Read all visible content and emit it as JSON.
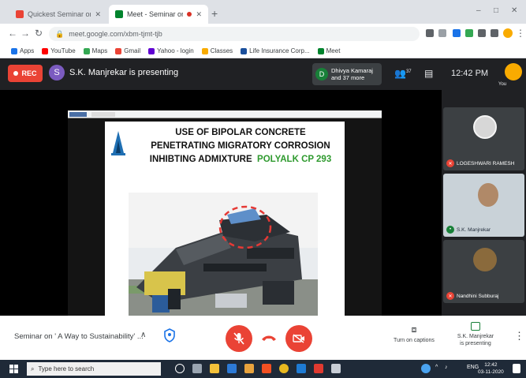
{
  "browser": {
    "tabs": [
      {
        "title": "Quickest Seminar on ' A Way t...",
        "favicon": "gmail-icon"
      },
      {
        "title": "Meet - Seminar on ' A Way t...",
        "favicon": "meet-icon",
        "active": true
      }
    ],
    "new_tab": "+",
    "window_controls": {
      "minimize": "–",
      "maximize": "□",
      "close": "✕"
    },
    "url": "meet.google.com/xbm-tjmt-tjb",
    "bookmarks": [
      "Apps",
      "YouTube",
      "Maps",
      "Gmail",
      "Yahoo - login",
      "Classes",
      "Life Insurance Corp...",
      "Meet"
    ]
  },
  "meet": {
    "rec_label": "REC",
    "presenter_initial": "S",
    "presenting_text": "S.K. Manjrekar is presenting",
    "joined": {
      "initial": "D",
      "line1": "Dhivya Kamaraj",
      "line2": "and 37 more"
    },
    "clock": "12:42 PM",
    "self_label": "You",
    "participant_count": "37",
    "slide": {
      "title_line1": "USE OF BIPOLAR CONCRETE",
      "title_line2": "PENETRATING MIGRATORY CORROSION",
      "title_line3_prefix": "INHIBTING ADMIXTURE",
      "title_line3_product": "POLYALK CP 293"
    },
    "participants": [
      {
        "name": "LOGESHWARI RAMESH"
      },
      {
        "name": "S.K. Manjrekar"
      },
      {
        "name": "Nandhini Subburaj"
      }
    ],
    "meeting_title": "Seminar on ' A Way to Sustainability' ...",
    "captions_label": "Turn on captions",
    "presenting_now_line1": "S.K. Manjrekar",
    "presenting_now_line2": "is presenting"
  },
  "taskbar": {
    "search_placeholder": "Type here to search",
    "lang": "ENG",
    "time": "12:42",
    "date": "03-11-2020"
  },
  "colors": {
    "meet_red": "#ea4335",
    "meet_dark": "#202124",
    "accent_green": "#188038"
  }
}
